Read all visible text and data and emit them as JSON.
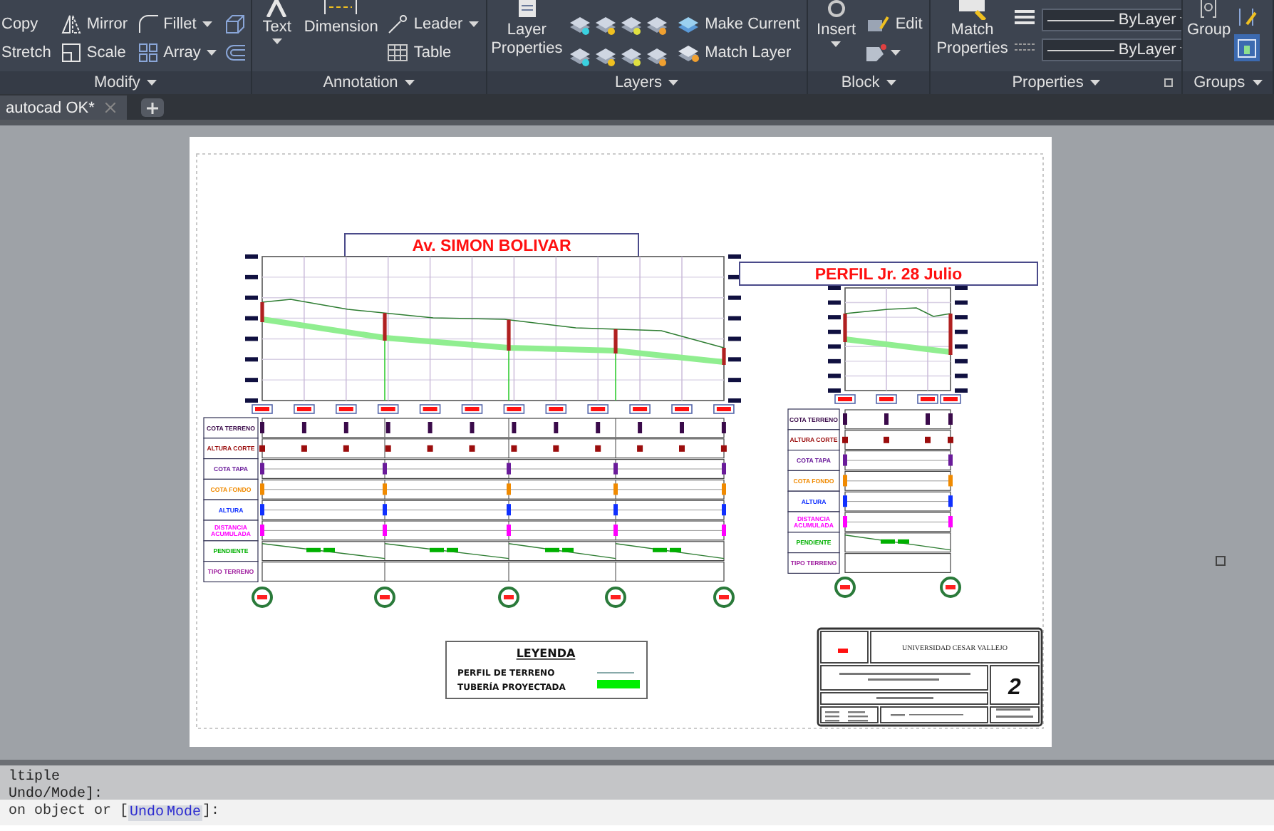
{
  "ribbon": {
    "panels": [
      {
        "kind": "modify",
        "title": "Modify",
        "tools": [
          {
            "label": "Copy",
            "dropdown": false
          },
          {
            "label": "Mirror",
            "dropdown": false
          },
          {
            "label": "Fillet",
            "dropdown": true
          },
          {
            "label": "Stretch",
            "dropdown": false
          },
          {
            "label": "Scale",
            "dropdown": false
          },
          {
            "label": "Array",
            "dropdown": true
          }
        ]
      },
      {
        "kind": "annotation",
        "title": "Annotation",
        "tools": [
          {
            "label": "Text",
            "dropdown": true
          },
          {
            "label": "Dimension",
            "dropdown": false
          },
          {
            "label": "Leader",
            "dropdown": true
          },
          {
            "label": "Table",
            "dropdown": false
          }
        ]
      },
      {
        "kind": "layers",
        "title": "Layers",
        "tools": [
          {
            "label": "Layer Properties",
            "dropdown": false
          },
          {
            "label": "Make Current",
            "dropdown": false
          },
          {
            "label": "Match Layer",
            "dropdown": false
          }
        ]
      },
      {
        "kind": "block",
        "title": "Block",
        "tools": [
          {
            "label": "Insert",
            "dropdown": true
          },
          {
            "label": "Edit",
            "dropdown": false
          }
        ]
      },
      {
        "kind": "properties",
        "title": "Properties",
        "tools": [
          {
            "label": "Match Properties",
            "dropdown": false
          }
        ],
        "fields": [
          {
            "value": "ByLayer"
          },
          {
            "value": "ByLayer"
          }
        ]
      },
      {
        "kind": "groups",
        "title": "Groups",
        "tools": [
          {
            "label": "Group",
            "dropdown": false
          }
        ]
      }
    ]
  },
  "tabs": [
    {
      "label": "autocad OK*",
      "selected": true
    }
  ],
  "drawing": {
    "profiles": [
      {
        "title": "Av. SIMON BOLIVAR",
        "rows": [
          {
            "label": "COTA TERRENO",
            "kind": "station",
            "color": "#3a0a4a"
          },
          {
            "label": "ALTURA CORTE",
            "kind": "station",
            "color": "#9b0d0d"
          },
          {
            "label": "COTA TAPA",
            "kind": "manhole",
            "color": "#6a1b9a"
          },
          {
            "label": "COTA FONDO",
            "kind": "manhole",
            "color": "#f08a00"
          },
          {
            "label": "ALTURA",
            "kind": "manhole",
            "color": "#1030ff"
          },
          {
            "label": "DISTANCIA ACUMULADA",
            "kind": "manhole",
            "color": "#ff00ff"
          },
          {
            "label": "PENDIENTE",
            "kind": "slope",
            "color": "#00b000"
          },
          {
            "label": "TIPO TERRENO",
            "kind": "empty",
            "color": "#a020a0"
          }
        ]
      },
      {
        "title": "PERFIL Jr. 28 Julio",
        "rows": [
          {
            "label": "COTA TERRENO",
            "kind": "station",
            "color": "#3a0a4a"
          },
          {
            "label": "ALTURA CORTE",
            "kind": "station",
            "color": "#9b0d0d"
          },
          {
            "label": "COTA TAPA",
            "kind": "manhole",
            "color": "#6a1b9a"
          },
          {
            "label": "COTA FONDO",
            "kind": "manhole",
            "color": "#f08a00"
          },
          {
            "label": "ALTURA",
            "kind": "manhole",
            "color": "#1030ff"
          },
          {
            "label": "DISTANCIA ACUMULADA",
            "kind": "manhole",
            "color": "#ff00ff"
          },
          {
            "label": "PENDIENTE",
            "kind": "slope",
            "color": "#00b000"
          },
          {
            "label": "TIPO TERRENO",
            "kind": "empty",
            "color": "#a020a0"
          }
        ]
      }
    ],
    "legend": {
      "title": "LEYENDA",
      "items": [
        {
          "label": "PERFIL DE TERRENO",
          "kind": "line"
        },
        {
          "label": "TUBERÍA PROYECTADA",
          "kind": "pipe"
        }
      ]
    },
    "title_block": {
      "institution": "UNIVERSIDAD CESAR VALLEJO",
      "sheet": "2"
    }
  },
  "command_line": {
    "history": [
      "ltiple",
      "Undo/Mode]:"
    ],
    "prompt": {
      "text": "on object or [",
      "options": [
        "Undo",
        "Mode"
      ],
      "end": "]:"
    }
  }
}
